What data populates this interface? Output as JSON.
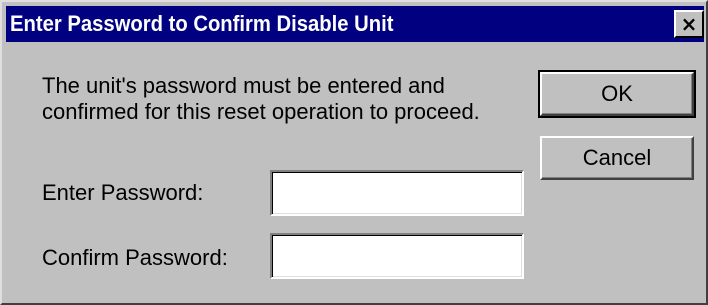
{
  "dialog": {
    "title": "Enter Password to Confirm Disable Unit",
    "close_glyph": "×",
    "message_line1": "The unit's password must be entered and",
    "message_line2": "confirmed for this reset operation to proceed.",
    "password_label": "Enter Password:",
    "password_value": "",
    "confirm_label": "Confirm Password:",
    "confirm_value": "",
    "ok_label": "OK",
    "cancel_label": "Cancel"
  },
  "colors": {
    "titlebar": "#000080",
    "title_text": "#ffffff",
    "face": "#c0c0c0",
    "field_bg": "#ffffff"
  },
  "icons": {
    "close": "close-icon"
  }
}
